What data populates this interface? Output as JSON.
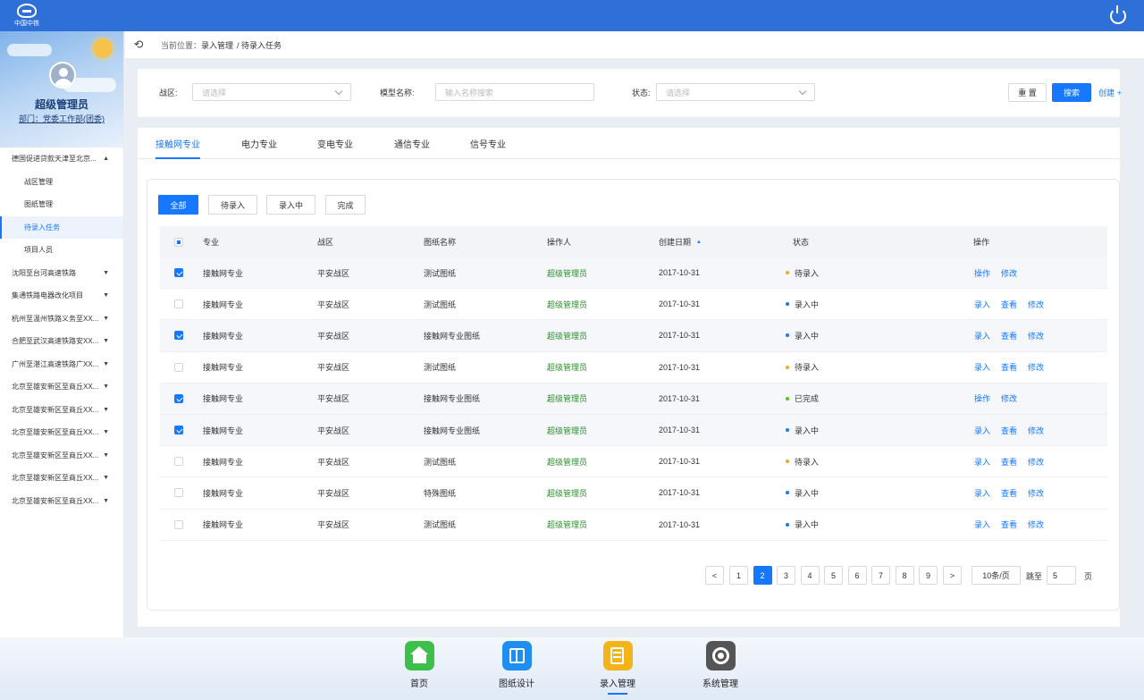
{
  "app": {
    "logo_text": "中国中铁"
  },
  "user": {
    "name": "超级管理员",
    "dept": "部门：党委工作部(团委)"
  },
  "sidebar": {
    "items": [
      {
        "label": "德国促进贷款天津至北京...",
        "caret": "▲",
        "level": 0
      },
      {
        "label": "战区管理",
        "caret": "",
        "level": 1
      },
      {
        "label": "图纸管理",
        "caret": "",
        "level": 1
      },
      {
        "label": "待录入任务",
        "caret": "",
        "level": 1,
        "active": true
      },
      {
        "label": "项目人员",
        "caret": "",
        "level": 1
      },
      {
        "label": "沈阳至台河高速铁路",
        "caret": "▼",
        "level": 0
      },
      {
        "label": "集通铁路电器改化项目",
        "caret": "▼",
        "level": 0
      },
      {
        "label": "杭州至温州铁路义务至XX...",
        "caret": "▼",
        "level": 0
      },
      {
        "label": "合肥至武汉高速铁路安XX...",
        "caret": "▼",
        "level": 0
      },
      {
        "label": "广州至湛江高速铁路广XX...",
        "caret": "▼",
        "level": 0
      },
      {
        "label": "北京至雄安新区至商丘XX...",
        "caret": "▼",
        "level": 0
      },
      {
        "label": "北京至雄安新区至商丘XX...",
        "caret": "▼",
        "level": 0
      },
      {
        "label": "北京至雄安新区至商丘XX...",
        "caret": "▼",
        "level": 0
      },
      {
        "label": "北京至雄安新区至商丘XX...",
        "caret": "▼",
        "level": 0
      },
      {
        "label": "北京至雄安新区至商丘XX...",
        "caret": "▼",
        "level": 0
      },
      {
        "label": "北京至雄安新区至商丘XX...",
        "caret": "▼",
        "level": 0
      }
    ]
  },
  "header": {
    "back": "⟲",
    "location_label": "当前位置：",
    "crumb1": "录入管理",
    "crumb2": "/ 待录入任务"
  },
  "filter": {
    "zone_label": "战区:",
    "zone_placeholder": "请选择",
    "model_label": "模型名称:",
    "model_placeholder": "输入名称搜索",
    "status_label": "状态:",
    "status_placeholder": "请选择",
    "reset": "重 置",
    "search": "搜索",
    "create": "创建 +"
  },
  "tabs": [
    "接触网专业",
    "电力专业",
    "变电专业",
    "通信专业",
    "信号专业"
  ],
  "segments": [
    "全部",
    "待录入",
    "录入中",
    "完成"
  ],
  "table": {
    "headers": {
      "major": "专业",
      "zone": "战区",
      "drawing": "图纸名称",
      "operator": "操作人",
      "date": "创建日期",
      "sort": "▲",
      "status": "状态",
      "actions": "操作"
    },
    "rows": [
      {
        "checked": true,
        "major": "接触网专业",
        "zone": "平安战区",
        "drawing": "测试图纸",
        "operator": "超级管理员",
        "date": "2017-10-31",
        "status": "待录入",
        "status_color": "#f5a623",
        "actions": [
          "操作",
          "修改"
        ]
      },
      {
        "checked": false,
        "major": "接触网专业",
        "zone": "平安战区",
        "drawing": "测试图纸",
        "operator": "超级管理员",
        "date": "2017-10-31",
        "status": "录入中",
        "status_color": "#1677ff",
        "actions": [
          "录入",
          "查看",
          "修改"
        ]
      },
      {
        "checked": true,
        "major": "接触网专业",
        "zone": "平安战区",
        "drawing": "接触网专业图纸",
        "operator": "超级管理员",
        "date": "2017-10-31",
        "status": "录入中",
        "status_color": "#1677ff",
        "actions": [
          "录入",
          "查看",
          "修改"
        ]
      },
      {
        "checked": false,
        "major": "接触网专业",
        "zone": "平安战区",
        "drawing": "测试图纸",
        "operator": "超级管理员",
        "date": "2017-10-31",
        "status": "待录入",
        "status_color": "#f5a623",
        "actions": [
          "录入",
          "查看",
          "修改"
        ]
      },
      {
        "checked": true,
        "major": "接触网专业",
        "zone": "平安战区",
        "drawing": "接触网专业图纸",
        "operator": "超级管理员",
        "date": "2017-10-31",
        "status": "已完成",
        "status_color": "#52c41a",
        "actions": [
          "操作",
          "修改"
        ]
      },
      {
        "checked": true,
        "major": "接触网专业",
        "zone": "平安战区",
        "drawing": "接触网专业图纸",
        "operator": "超级管理员",
        "date": "2017-10-31",
        "status": "录入中",
        "status_color": "#1677ff",
        "actions": [
          "录入",
          "查看",
          "修改"
        ]
      },
      {
        "checked": false,
        "major": "接触网专业",
        "zone": "平安战区",
        "drawing": "测试图纸",
        "operator": "超级管理员",
        "date": "2017-10-31",
        "status": "待录入",
        "status_color": "#f5a623",
        "actions": [
          "录入",
          "查看",
          "修改"
        ]
      },
      {
        "checked": false,
        "major": "接触网专业",
        "zone": "平安战区",
        "drawing": "特殊图纸",
        "operator": "超级管理员",
        "date": "2017-10-31",
        "status": "录入中",
        "status_color": "#1677ff",
        "actions": [
          "录入",
          "查看",
          "修改"
        ]
      },
      {
        "checked": false,
        "major": "接触网专业",
        "zone": "平安战区",
        "drawing": "测试图纸",
        "operator": "超级管理员",
        "date": "2017-10-31",
        "status": "录入中",
        "status_color": "#1677ff",
        "actions": [
          "录入",
          "查看",
          "修改"
        ]
      }
    ]
  },
  "pagination": {
    "prev": "<",
    "next": ">",
    "pages": [
      "1",
      "2",
      "3",
      "4",
      "5",
      "6",
      "7",
      "8",
      "9"
    ],
    "current": "2",
    "page_size": "10条/页",
    "jump_label": "跳至",
    "jump_value": "5",
    "page_suffix": "页"
  },
  "dock": {
    "items": [
      {
        "label": "首页",
        "icon": "home-icon",
        "color": "#3cc04a"
      },
      {
        "label": "图纸设计",
        "icon": "map-icon",
        "color": "#1e8ef0"
      },
      {
        "label": "录入管理",
        "icon": "edit-icon",
        "color": "#f3b41a",
        "active": true
      },
      {
        "label": "系统管理",
        "icon": "settings-icon",
        "color": "#555555"
      }
    ]
  },
  "colors": {
    "primary": "#1677ff",
    "topbar": "#2f6fd8",
    "operator_green": "#2b8f2b"
  }
}
